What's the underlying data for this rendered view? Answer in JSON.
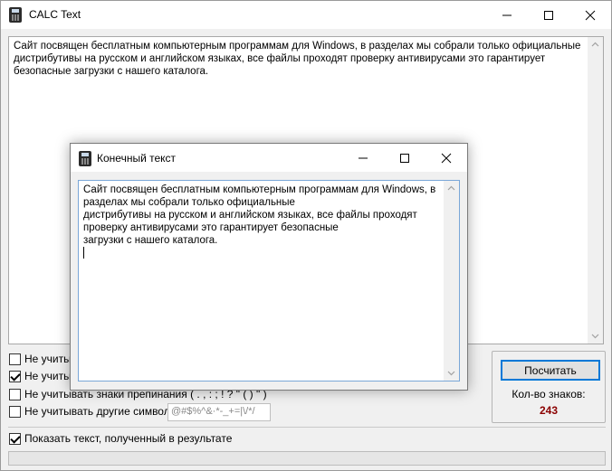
{
  "window": {
    "title": "CALC Text",
    "minimize_icon": "minimize-icon",
    "maximize_icon": "maximize-icon",
    "close_icon": "close-icon"
  },
  "main_text": {
    "value": "Сайт посвящен бесплатным компьютерным программам для Windows, в разделах мы собрали только официальные дистрибутивы на русском и английском языках, все файлы проходят проверку антивирусами это гарантирует безопасные загрузки с нашего каталога."
  },
  "options": [
    {
      "label": "Не учитыв",
      "checked": false
    },
    {
      "label": "Не учитыв",
      "checked": true
    },
    {
      "label": "Не учитывать знаки препинания ( . , : ; ! ? \" ( ) \" )",
      "checked": false
    },
    {
      "label": "Не учитывать другие символы",
      "checked": false
    }
  ],
  "symbols_input": {
    "value": "@#$%^&·*-_+=|\\/*/"
  },
  "show_result": {
    "label": "Показать текст, полученный в результате",
    "checked": true
  },
  "calc": {
    "button_label": "Посчитать",
    "count_label": "Кол-во знаков:",
    "count_value": "243"
  },
  "progress": {
    "value": 0
  },
  "modal": {
    "title": "Конечный текст",
    "text": "Сайт посвящен бесплатным компьютерным программам для Windows, в\nразделах мы собрали только официальные\nдистрибутивы на русском и английском языках, все файлы проходят\nпроверку антивирусами это гарантирует безопасные\nзагрузки с нашего каталога.\n"
  },
  "colors": {
    "accent": "#0078d7",
    "count_value": "#8b0000"
  }
}
